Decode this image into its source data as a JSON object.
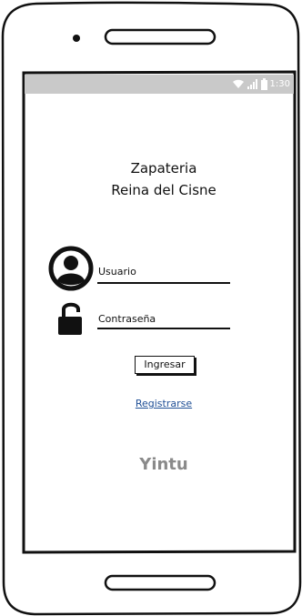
{
  "status_bar": {
    "time": "1:30",
    "wifi_icon": "wifi-icon",
    "signal_icon": "signal-icon",
    "battery_icon": "battery-icon"
  },
  "app": {
    "title_line1": "Zapateria",
    "title_line2": "Reina del Cisne"
  },
  "form": {
    "username_label": "Usuario",
    "username_icon": "user-icon",
    "password_label": "Contraseña",
    "password_icon": "unlock-icon",
    "submit_label": "Ingresar",
    "register_label": "Registrarse"
  },
  "footer": {
    "brand": "Yintu"
  },
  "colors": {
    "status_bar": "#c9c9c9",
    "link": "#1f4f96",
    "brand_text": "#8a8a8a",
    "ink": "#111111"
  }
}
